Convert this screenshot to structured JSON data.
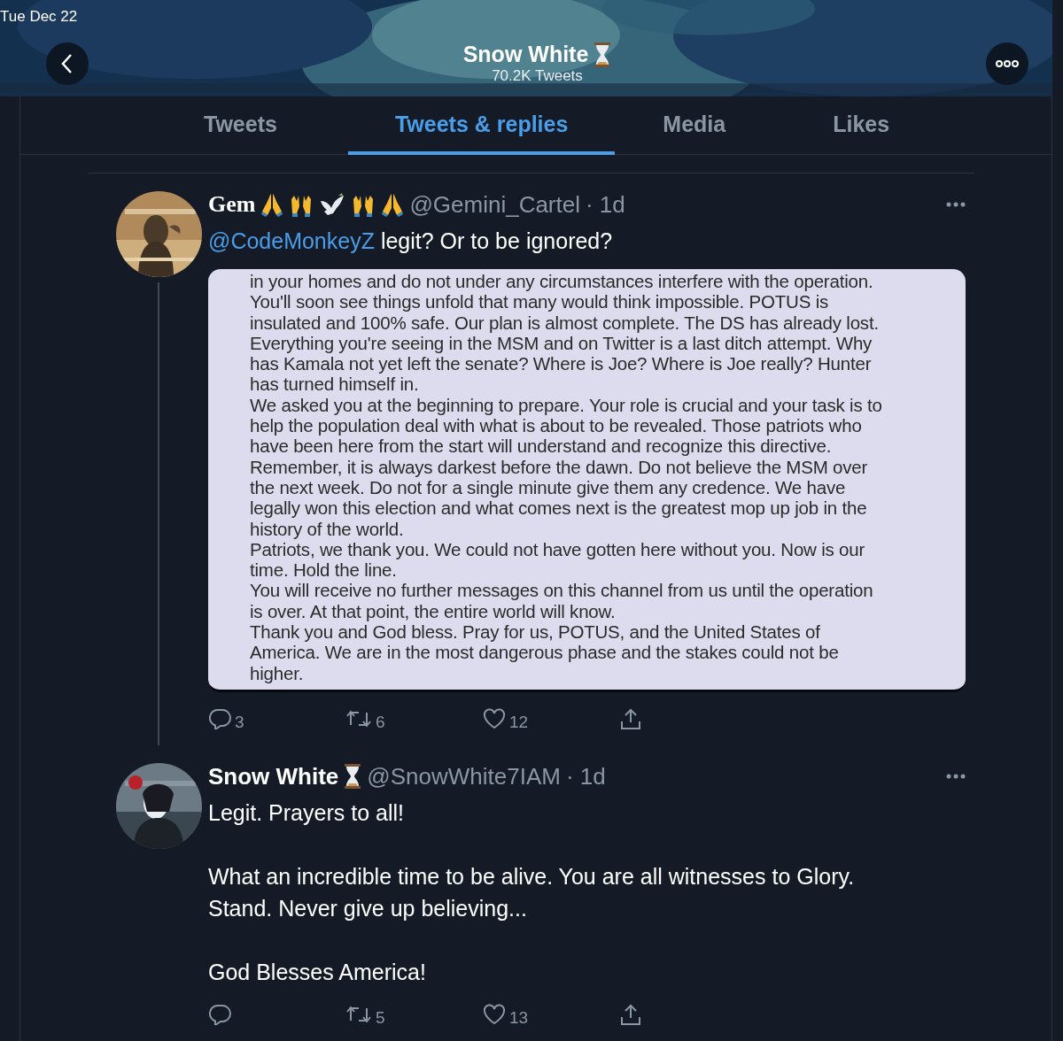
{
  "status_bar": {
    "date": "Tue Dec 22"
  },
  "header": {
    "title": "Snow White",
    "subtitle": "70.2K Tweets"
  },
  "tabs": [
    {
      "label": "Tweets",
      "selected": false
    },
    {
      "label": "Tweets & replies",
      "selected": true
    },
    {
      "label": "Media",
      "selected": false
    },
    {
      "label": "Likes",
      "selected": false
    }
  ],
  "tweets": [
    {
      "name": "Gem",
      "handle": "@Gemini_Cartel",
      "time": "· 1d",
      "text": [
        {
          "mention": "@CodeMonkeyZ",
          "rest": " legit? Or to be ignored?"
        }
      ],
      "document": [
        "in your homes and do not under any circumstances interfere with the operation. You'll soon see things unfold that many would think impossible. POTUS is insulated and 100% safe. Our plan is almost complete. The DS has already lost. Everything you're seeing in the MSM and on Twitter is a last ditch attempt. Why has Kamala not yet left the senate? Where is Joe? Where is Joe really? Hunter has turned himself in.",
        "We asked you at the beginning to prepare. Your role is crucial and your task is to help the population deal with what is about to be revealed. Those patriots who have been here from the start will understand and recognize this directive.",
        "Remember, it is always darkest before the dawn. Do not believe the MSM over the next week. Do not for a single minute give them any credence. We have legally won this election and what comes next is the greatest mop up job in the history of the world.",
        "Patriots, we thank you. We could not have gotten here without you. Now is our time. Hold the line.",
        "You will receive no further messages on this channel from us until the operation is over. At that point, the entire world will know.",
        "Thank you and God bless. Pray for us, POTUS, and the United States of America. We are in the most dangerous phase and the stakes could not be higher."
      ],
      "replies": "3",
      "retweets": "6",
      "likes": "12"
    },
    {
      "name": "Snow White",
      "handle": "@SnowWhite7IAM",
      "time": "· 1d",
      "text": [
        {
          "rest": "Legit. Prayers to all!"
        },
        {
          "rest": "What an incredible time to be alive. You are all witnesses to Glory. Stand. Never give up believing..."
        },
        {
          "rest": "God Blesses America!"
        }
      ],
      "retweets": "5",
      "likes": "13"
    }
  ]
}
